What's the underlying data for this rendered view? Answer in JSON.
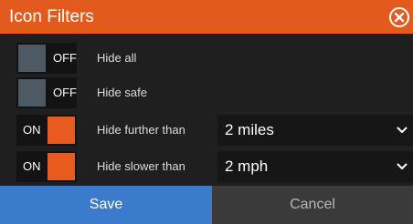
{
  "dialog": {
    "title": "Icon Filters",
    "close_icon": "close-circle-icon"
  },
  "colors": {
    "title_bar": "#e35a1e",
    "toggle_on": "#e95a1e",
    "toggle_off": "#4e5a63",
    "save_button": "#3b7bcb",
    "cancel_button": "#3a3a3a",
    "background": "#1f1f1f"
  },
  "filters": [
    {
      "label": "Hide all",
      "state": "OFF",
      "on": false
    },
    {
      "label": "Hide safe",
      "state": "OFF",
      "on": false
    },
    {
      "label": "Hide further than",
      "state": "ON",
      "on": true,
      "value": "2 miles",
      "dropdown_icon": "chevron-down-icon"
    },
    {
      "label": "Hide slower than",
      "state": "ON",
      "on": true,
      "value": "2 mph",
      "dropdown_icon": "chevron-down-icon"
    }
  ],
  "buttons": {
    "save": "Save",
    "cancel": "Cancel"
  }
}
